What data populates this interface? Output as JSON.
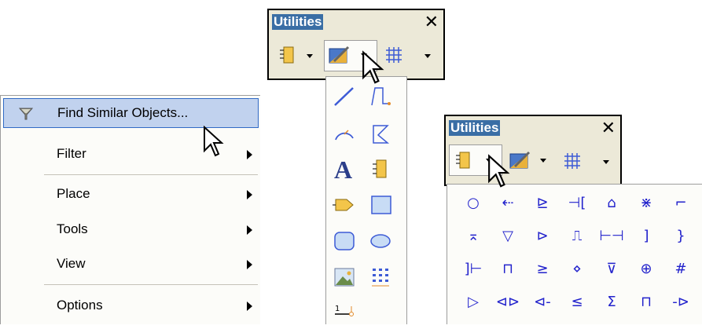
{
  "context_menu": {
    "items": [
      {
        "label": "Find Similar Objects...",
        "highlighted": true,
        "has_submenu": false,
        "icon": "funnel-icon"
      },
      {
        "label": "Filter",
        "has_submenu": true
      },
      {
        "label": "Place",
        "has_submenu": true
      },
      {
        "label": "Tools",
        "has_submenu": true
      },
      {
        "label": "View",
        "has_submenu": true
      },
      {
        "label": "Options",
        "has_submenu": true
      }
    ]
  },
  "utilities_top": {
    "title": "Utilities",
    "close_label": "✕",
    "buttons": [
      "component-icon",
      "drawing-tools-icon",
      "grid-icon"
    ],
    "open_dropdown": "drawing-tools"
  },
  "drawing_tools": {
    "tools": [
      "line-icon",
      "bezier-icon",
      "arc-icon",
      "polygon-icon",
      "text-icon",
      "part-icon",
      "port-icon",
      "rectangle-icon",
      "rounded-rectangle-icon",
      "ellipse-icon",
      "image-icon",
      "array-icon",
      "pin-icon"
    ],
    "text_tool_glyph": "A"
  },
  "utilities_bottom": {
    "title": "Utilities",
    "close_label": "✕",
    "buttons": [
      "component-icon",
      "drawing-tools-icon",
      "grid-icon"
    ],
    "open_dropdown": "power-objects"
  },
  "power_objects": {
    "rows": [
      [
        "○",
        "⇠",
        "⊵",
        "⊣[",
        "⌂",
        "⋇",
        "⌐"
      ],
      [
        "⌅",
        "▽",
        "⊳",
        "⎍",
        "⊢⊣",
        "]",
        "}"
      ],
      [
        "]⊢",
        "⊓",
        "≥",
        "⋄",
        "⊽",
        "⊕",
        "#"
      ],
      [
        "▷",
        "⊲⊳",
        "⊲-",
        "≤",
        "Σ",
        "⊓",
        "-⊳"
      ]
    ],
    "symbol_color": "#2222cc"
  },
  "colors": {
    "menu_highlight": "#c1d2ee",
    "menu_highlight_border": "#316ac5",
    "toolbar_bg": "#ece9d8",
    "title_accent": "#3a6ea5"
  }
}
